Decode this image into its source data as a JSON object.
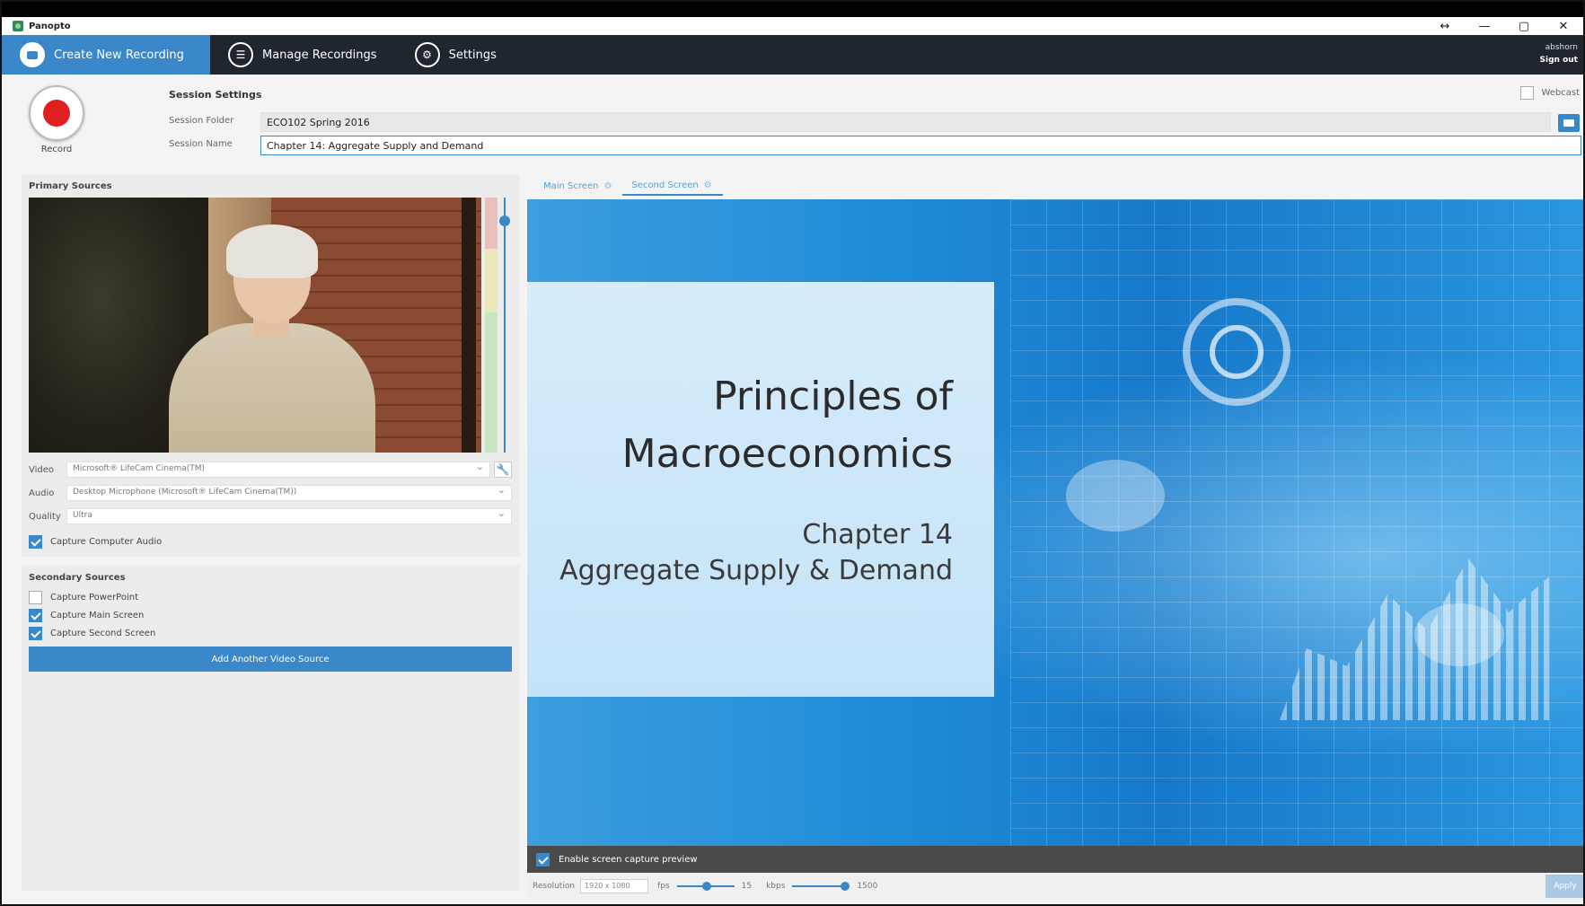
{
  "window": {
    "title": "Panopto",
    "controls": {
      "restore": "↔",
      "minimize": "—",
      "maximize": "▢",
      "close": "✕"
    }
  },
  "nav": {
    "tabs": [
      {
        "label": "Create New Recording",
        "icon": "camera-icon",
        "active": true
      },
      {
        "label": "Manage Recordings",
        "icon": "list-icon",
        "active": false
      },
      {
        "label": "Settings",
        "icon": "gear-icon",
        "active": false
      }
    ],
    "user": {
      "name": "abshorn",
      "signout": "Sign out"
    }
  },
  "session": {
    "record_label": "Record",
    "title": "Session Settings",
    "folder_label": "Session Folder",
    "folder_value": "ECO102 Spring 2016",
    "name_label": "Session Name",
    "name_value": "Chapter 14: Aggregate Supply and Demand",
    "webcast_label": "Webcast"
  },
  "primary": {
    "title": "Primary Sources",
    "video_label": "Video",
    "video_value": "Microsoft® LifeCam Cinema(TM)",
    "audio_label": "Audio",
    "audio_value": "Desktop Microphone (Microsoft® LifeCam Cinema(TM))",
    "quality_label": "Quality",
    "quality_value": "Ultra",
    "capture_audio_label": "Capture Computer Audio"
  },
  "secondary": {
    "title": "Secondary Sources",
    "items": [
      {
        "label": "Capture PowerPoint",
        "checked": false
      },
      {
        "label": "Capture Main Screen",
        "checked": true
      },
      {
        "label": "Capture Second Screen",
        "checked": true
      }
    ],
    "add_button": "Add Another Video Source"
  },
  "preview": {
    "tabs": [
      {
        "label": "Main Screen",
        "active": false
      },
      {
        "label": "Second Screen",
        "active": true
      }
    ],
    "slide": {
      "title_line1": "Principles of",
      "title_line2": "Macroeconomics",
      "sub_line1": "Chapter 14",
      "sub_line2": "Aggregate Supply & Demand"
    },
    "enable_label": "Enable screen capture preview",
    "resolution_label": "Resolution",
    "resolution_value": "1920 x 1080",
    "fps_label": "fps",
    "fps_value": "15",
    "kbps_label": "kbps",
    "kbps_value": "1500",
    "apply_label": "Apply"
  },
  "colors": {
    "accent": "#3a87c9",
    "navbar": "#20262e",
    "record": "#e02020"
  }
}
